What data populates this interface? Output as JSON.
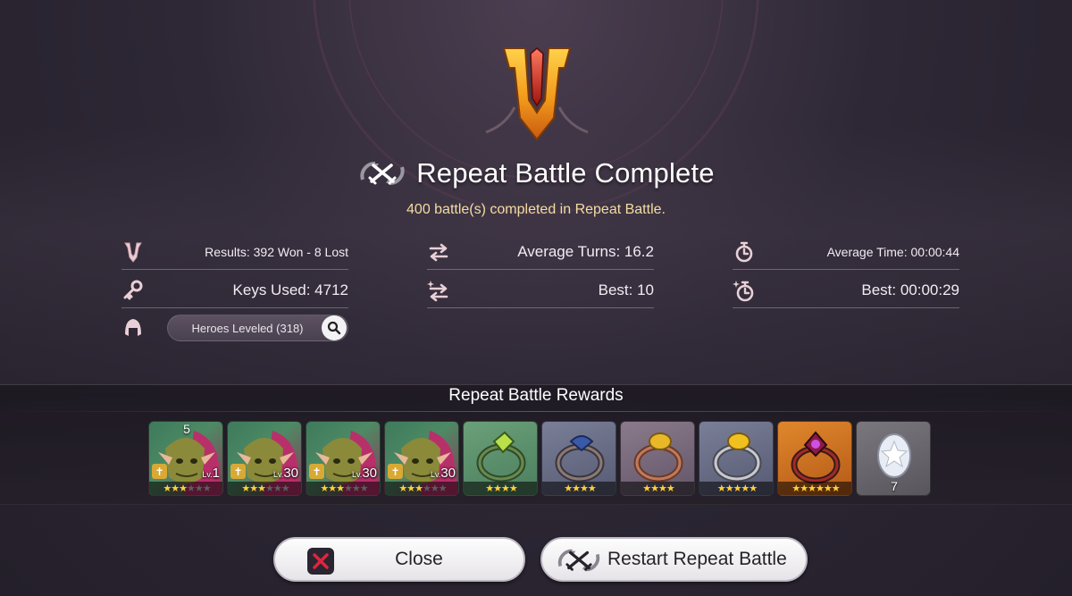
{
  "header": {
    "title": "Repeat Battle Complete",
    "subtitle": "400 battle(s) completed in Repeat Battle."
  },
  "stats": {
    "results": "Results: 392 Won - 8 Lost",
    "keys_used": "Keys Used: 4712",
    "average_turns": "Average Turns: 16.2",
    "best_turns": "Best: 10",
    "average_time": "Average Time: 00:00:44",
    "best_time": "Best: 00:00:29",
    "heroes_leveled": "Heroes Leveled (318)"
  },
  "rewards": {
    "title": "Repeat Battle Rewards",
    "items": [
      {
        "kind": "hero",
        "count": "5",
        "level_prefix": "Lv.",
        "level": "1",
        "stars": 3,
        "max_stars": 6
      },
      {
        "kind": "hero",
        "count": "",
        "level_prefix": "Lv.",
        "level": "30",
        "stars": 3,
        "max_stars": 6
      },
      {
        "kind": "hero",
        "count": "",
        "level_prefix": "Lv.",
        "level": "30",
        "stars": 3,
        "max_stars": 6
      },
      {
        "kind": "hero",
        "count": "",
        "level_prefix": "Lv.",
        "level": "30",
        "stars": 3,
        "max_stars": 6
      },
      {
        "kind": "ring",
        "rarity": "green",
        "stars": 4
      },
      {
        "kind": "ring",
        "rarity": "blue",
        "stars": 4
      },
      {
        "kind": "ring",
        "rarity": "purple",
        "stars": 4
      },
      {
        "kind": "ring",
        "rarity": "blue",
        "stars": 5
      },
      {
        "kind": "ring",
        "rarity": "orange",
        "stars": 6
      },
      {
        "kind": "egg",
        "count": "7"
      }
    ]
  },
  "buttons": {
    "close": "Close",
    "restart": "Restart Repeat Battle"
  },
  "colors": {
    "accent_gold": "#f4dca2",
    "emblem_orange": "#f0a020",
    "emblem_red": "#c8281e",
    "star_yellow": "#ffd23a",
    "close_red": "#e0243e"
  },
  "icons": {
    "emblem": "victory-v-emblem-icon",
    "repeat_battle": "repeat-battle-swords-icon",
    "results": "v-shield-icon",
    "keys": "key-icon",
    "turns": "swap-arrows-icon",
    "best_turns": "swap-arrows-sparkle-icon",
    "time": "stopwatch-icon",
    "best_time": "stopwatch-sparkle-icon",
    "heroes": "helmet-icon",
    "search": "search-icon",
    "close": "close-icon"
  }
}
